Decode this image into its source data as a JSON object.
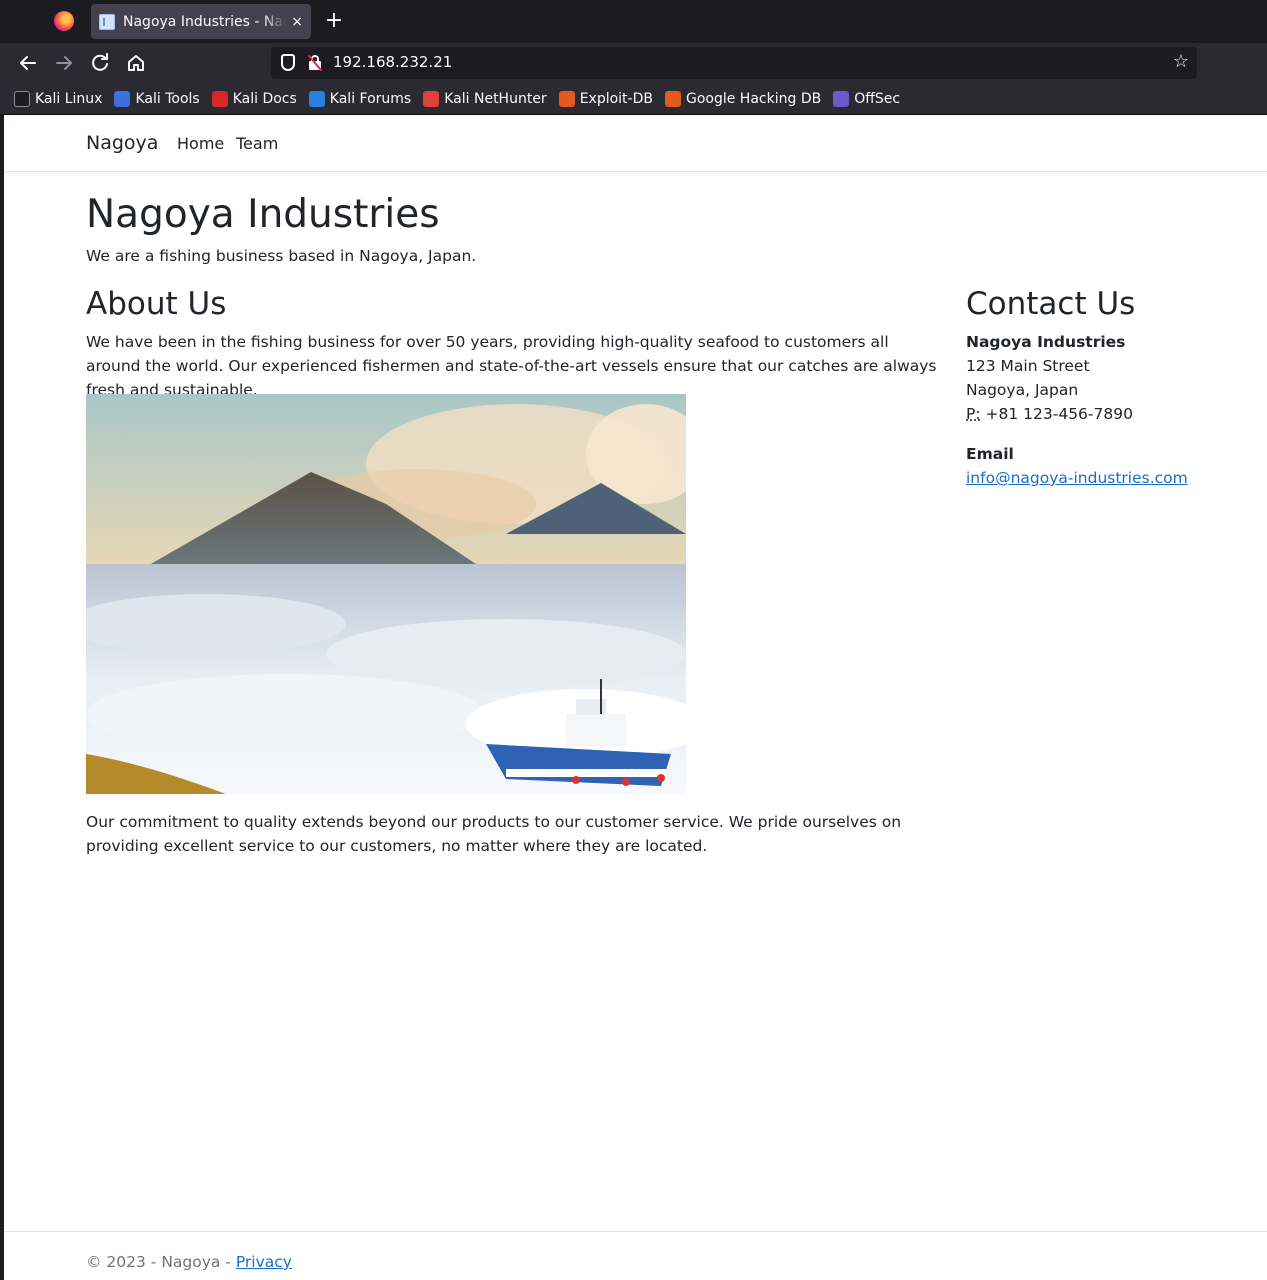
{
  "browser": {
    "tab_title": "Nagoya Industries - Nagoya",
    "tab_close": "×",
    "new_tab": "+",
    "url": "192.168.232.21",
    "icons": [
      "firefox-icon",
      "back-icon",
      "forward-icon",
      "reload-icon",
      "home-icon",
      "shield-icon",
      "insecure-lock-icon",
      "bookmark-star-icon"
    ],
    "bookmarks": [
      {
        "label": "Kali Linux",
        "icon": "kali-dragon-icon",
        "color": "#1c1b22"
      },
      {
        "label": "Kali Tools",
        "icon": "kali-tools-icon",
        "color": "#3d6fe0"
      },
      {
        "label": "Kali Docs",
        "icon": "kali-docs-icon",
        "color": "#d62828"
      },
      {
        "label": "Kali Forums",
        "icon": "kali-forums-icon",
        "color": "#2a7de1"
      },
      {
        "label": "Kali NetHunter",
        "icon": "nethunter-icon",
        "color": "#e0403a"
      },
      {
        "label": "Exploit-DB",
        "icon": "exploit-db-icon",
        "color": "#e25a1c"
      },
      {
        "label": "Google Hacking DB",
        "icon": "ghdb-icon",
        "color": "#e25a1c"
      },
      {
        "label": "OffSec",
        "icon": "offsec-icon",
        "color": "#6a5acd"
      }
    ]
  },
  "site": {
    "brand": "Nagoya",
    "nav": [
      "Home",
      "Team"
    ],
    "title": "Nagoya Industries",
    "lead": "We are a fishing business based in Nagoya, Japan.",
    "about": {
      "heading": "About Us",
      "p1": "We have been in the fishing business for over 50 years, providing high-quality seafood to customers all around the world. Our experienced fishermen and state-of-the-art vessels ensure that our catches are always fresh and sustainable.",
      "p2": "Our commitment to quality extends beyond our products to our customer service. We pride ourselves on providing excellent service to our customers, no matter where they are located."
    },
    "contact": {
      "heading": "Contact Us",
      "name": "Nagoya Industries",
      "street": "123 Main Street",
      "city": "Nagoya, Japan",
      "phone_label": "P:",
      "phone": "+81 123-456-7890",
      "email_heading": "Email",
      "email": "info@nagoya-industries.com"
    },
    "footer": {
      "text": "© 2023 - Nagoya - ",
      "privacy": "Privacy"
    }
  }
}
